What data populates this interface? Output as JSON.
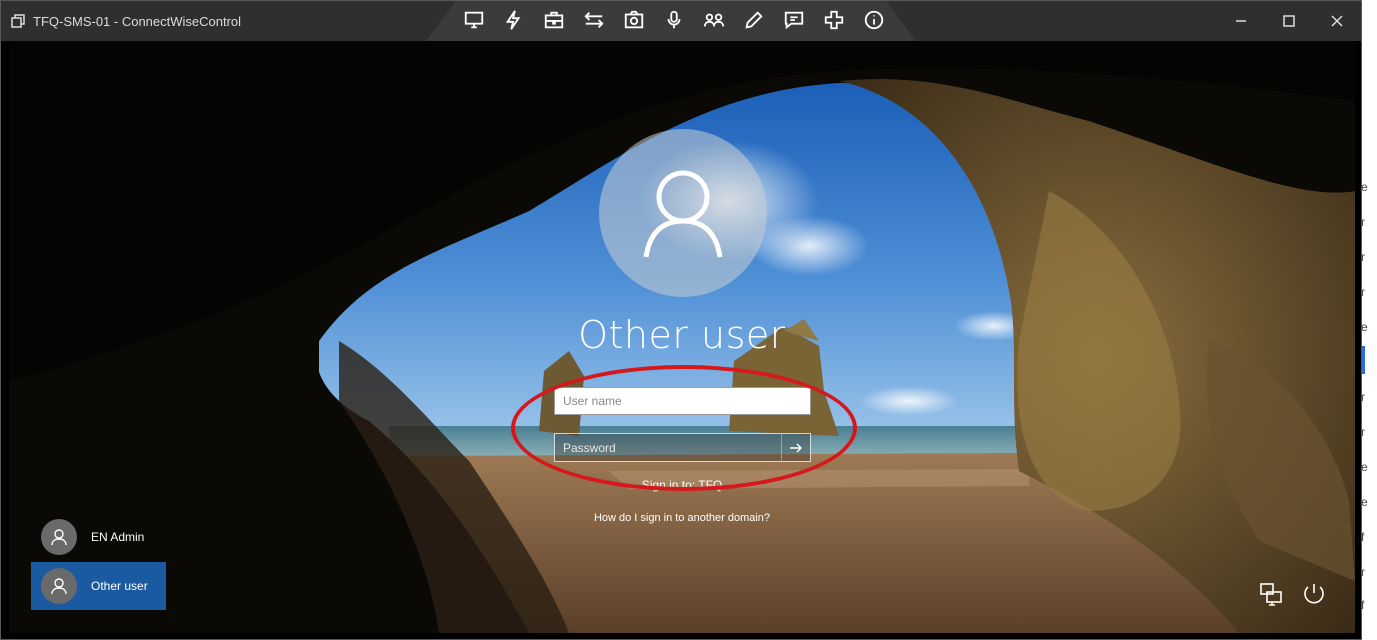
{
  "window": {
    "title": "TFQ-SMS-01 - ConnectWiseControl",
    "toolbar_icons": [
      "monitor-icon",
      "lightning-icon",
      "toolbox-icon",
      "transfer-arrows-icon",
      "camera-icon",
      "microphone-icon",
      "users-icon",
      "pencil-icon",
      "chat-icon",
      "plus-cross-icon",
      "info-icon"
    ],
    "controls": [
      "minimize-icon",
      "maximize-icon",
      "close-icon"
    ]
  },
  "lockscreen": {
    "current_user": "Other user",
    "username_placeholder": "User name",
    "password_placeholder": "Password",
    "sign_in_to": "Sign in to: TFQ",
    "other_domain_link": "How do I sign in to another domain?",
    "users": [
      {
        "name": "EN Admin",
        "selected": false
      },
      {
        "name": "Other user",
        "selected": true
      }
    ],
    "bottom_icons": [
      "network-icon",
      "power-icon"
    ]
  },
  "background_app": {
    "fragments": [
      "e",
      "r",
      "r",
      "r",
      "e",
      "r",
      "r",
      "e",
      "e",
      "f",
      "r",
      "f"
    ]
  },
  "colors": {
    "titlebar": "#2f2f2f",
    "selected_tile": "#1a5aa0",
    "annotation": "#d4181c"
  }
}
